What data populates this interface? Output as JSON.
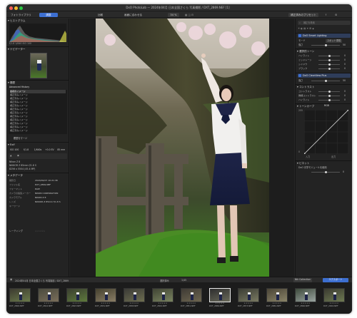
{
  "window": {
    "title": "DxO PhotoLab — 2024年04月 日本全国さくら 写真撮影  / DXT_2869.NEF [1]"
  },
  "colors": {
    "accent": "#3d6fd1",
    "mac_close": "#fe5f57",
    "mac_min": "#febc2e",
    "mac_max": "#28c840"
  },
  "toolbar": {
    "tab_library": "フォトライブラリ",
    "tab_customize": "調整",
    "compare": "比較",
    "fit": "画面に合わせる",
    "zoom": "34 %",
    "preset_button": "補正済みのプリセット",
    "export_button": "エクスポート",
    "search_icon": "search-icon"
  },
  "left": {
    "histogram_title": "ヒストグラム",
    "histogram_stats": "f/1.8  1/640  ISO 100",
    "navigator_title": "ナビゲーター",
    "history_title": "履歴",
    "history_header": "Advanced History",
    "history_items": [
      "最初のイメージ",
      "補正済みイメージ",
      "補正済みイメージ",
      "補正済みイメージ",
      "補正済みイメージ",
      "補正済みイメージ",
      "補正済みイメージ",
      "補正済みイメージ",
      "補正済みイメージ",
      "補正済みイメージ",
      "補正済みイメージ",
      "補正済みイメージ"
    ],
    "history_button": "履歴をマージ",
    "exif_title": "Exif",
    "exif_top": [
      "ISO 100",
      "f/1.8",
      "1/640s",
      "+0.0 EV",
      "85 mm"
    ],
    "exif_camera_line": "Nikon Z 8",
    "exif_lens": "NIKKOR Z 85mm f/1.8 S",
    "exif_size": "8256 x 5504 (45.4 MP)",
    "meta_title": "メタデータ",
    "meta_rows": [
      {
        "k": "撮影日",
        "v": "2024/04/07 10:21:38"
      },
      {
        "k": "ファイル名",
        "v": "DXT_2869.NEF"
      },
      {
        "k": "フォーマット",
        "v": "RAW"
      },
      {
        "k": "カメラの製造メーカー",
        "v": "NIKON CORPORATION"
      },
      {
        "k": "カメラモデル",
        "v": "NIKON Z 8"
      },
      {
        "k": "レンズ",
        "v": "NIKKOR Z 85mm f/1.8 S"
      },
      {
        "k": "キーワード",
        "v": ""
      }
    ],
    "rating_label": "レーティング"
  },
  "right": {
    "search_placeholder": "補正を検索",
    "group_lighting": "DxO Smart Lighting",
    "mode_label": "モード",
    "mode_value": "スポット重視",
    "strength_label": "強さ",
    "strength_value": "50",
    "tones_title": "選択的トーン",
    "tone_rows": [
      {
        "label": "ハイライト",
        "value": "0"
      },
      {
        "label": "ミッドトーン",
        "value": "0"
      },
      {
        "label": "シャドウ",
        "value": "0"
      },
      {
        "label": "ブラック",
        "value": "0"
      }
    ],
    "clearview_title": "DxO ClearView Plus",
    "clearview_strength": "50",
    "contrast_title": "コントラスト",
    "contrast_rows": [
      {
        "label": "コントラスト",
        "value": "0"
      },
      {
        "label": "微細コントラスト",
        "value": "0"
      },
      {
        "label": "ハイライト",
        "value": "0"
      }
    ],
    "curve_title": "トーンカーブ",
    "curve_channel": "RGB",
    "curve_in": "入力",
    "curve_out": "出力",
    "curve_max": "255",
    "curve_min": "0",
    "vignette_title": "ビネット",
    "vignette_value": "0",
    "vignette_row": "DxO 光学モジュールを使用"
  },
  "bottombar": {
    "folder": "2024年04月 日本全国さくら 写真撮影  / DXT_2869",
    "selection": "選択済み",
    "count": "1/45",
    "nik_button": "Nik Collection",
    "export_button": "エクスポート"
  },
  "filmstrip": {
    "items": [
      {
        "name": "DXT_2800.NEF"
      },
      {
        "name": "DXT_2812.NEF"
      },
      {
        "name": "DXT_2823.NEF"
      },
      {
        "name": "DXT_2831.NEF"
      },
      {
        "name": "DXT_2838.NEF"
      },
      {
        "name": "DXT_2844.NEF"
      },
      {
        "name": "DXT_2851.NEF"
      },
      {
        "name": "DXT_2869.NEF"
      },
      {
        "name": "DXT_2873.NEF"
      },
      {
        "name": "DXT_2881.NEF"
      },
      {
        "name": "DXT_2890.NEF"
      },
      {
        "name": "DXT_2902.NEF"
      }
    ]
  }
}
